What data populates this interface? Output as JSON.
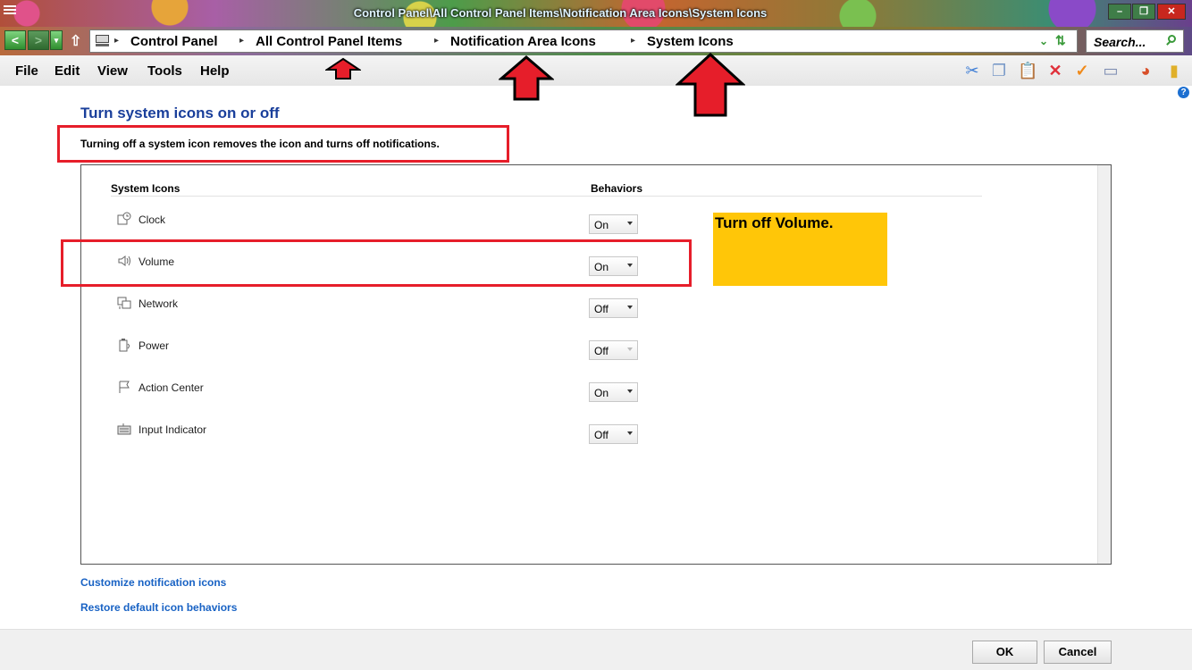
{
  "window": {
    "title": "Control Panel\\All Control Panel Items\\Notification Area Icons\\System Icons",
    "min_label": "–",
    "max_label": "❐",
    "close_label": "✕"
  },
  "nav": {
    "back": "<",
    "forward": ">",
    "dropdown": "▾",
    "up": "⇧"
  },
  "address": {
    "crumbs": [
      "Control Panel",
      "All Control Panel Items",
      "Notification Area Icons",
      "System Icons"
    ],
    "separator": "▸",
    "dropdown": "⌄",
    "refresh": "⇅"
  },
  "search": {
    "placeholder": "Search..."
  },
  "menu": {
    "items": [
      "File",
      "Edit",
      "View",
      "Tools",
      "Help"
    ]
  },
  "toolbar": {
    "icons": [
      "cut-icon",
      "copy-icon",
      "paste-icon",
      "delete-icon",
      "check-icon",
      "properties-icon",
      "color-wheel-icon",
      "folder-icon"
    ]
  },
  "help": {
    "label": "?"
  },
  "page": {
    "title": "Turn system icons on or off",
    "description": "Turning off a system icon removes the icon and turns off notifications."
  },
  "table": {
    "col_icons": "System Icons",
    "col_behaviors": "Behaviors",
    "rows": [
      {
        "icon": "clock-icon",
        "label": "Clock",
        "value": "On",
        "enabled": true
      },
      {
        "icon": "speaker-icon",
        "label": "Volume",
        "value": "On",
        "enabled": true
      },
      {
        "icon": "network-icon",
        "label": "Network",
        "value": "Off",
        "enabled": true
      },
      {
        "icon": "power-icon",
        "label": "Power",
        "value": "Off",
        "enabled": false
      },
      {
        "icon": "flag-icon",
        "label": "Action Center",
        "value": "On",
        "enabled": true
      },
      {
        "icon": "keyboard-icon",
        "label": "Input Indicator",
        "value": "Off",
        "enabled": true
      }
    ]
  },
  "note": {
    "text": "Turn off Volume."
  },
  "links": {
    "customize": "Customize notification icons",
    "restore": "Restore default icon behaviors"
  },
  "buttons": {
    "ok": "OK",
    "cancel": "Cancel"
  },
  "colors": {
    "annotation_red": "#e61e2a",
    "note_yellow": "#ffc608",
    "title_blue": "#1a3f9b",
    "link_blue": "#1862c4"
  }
}
